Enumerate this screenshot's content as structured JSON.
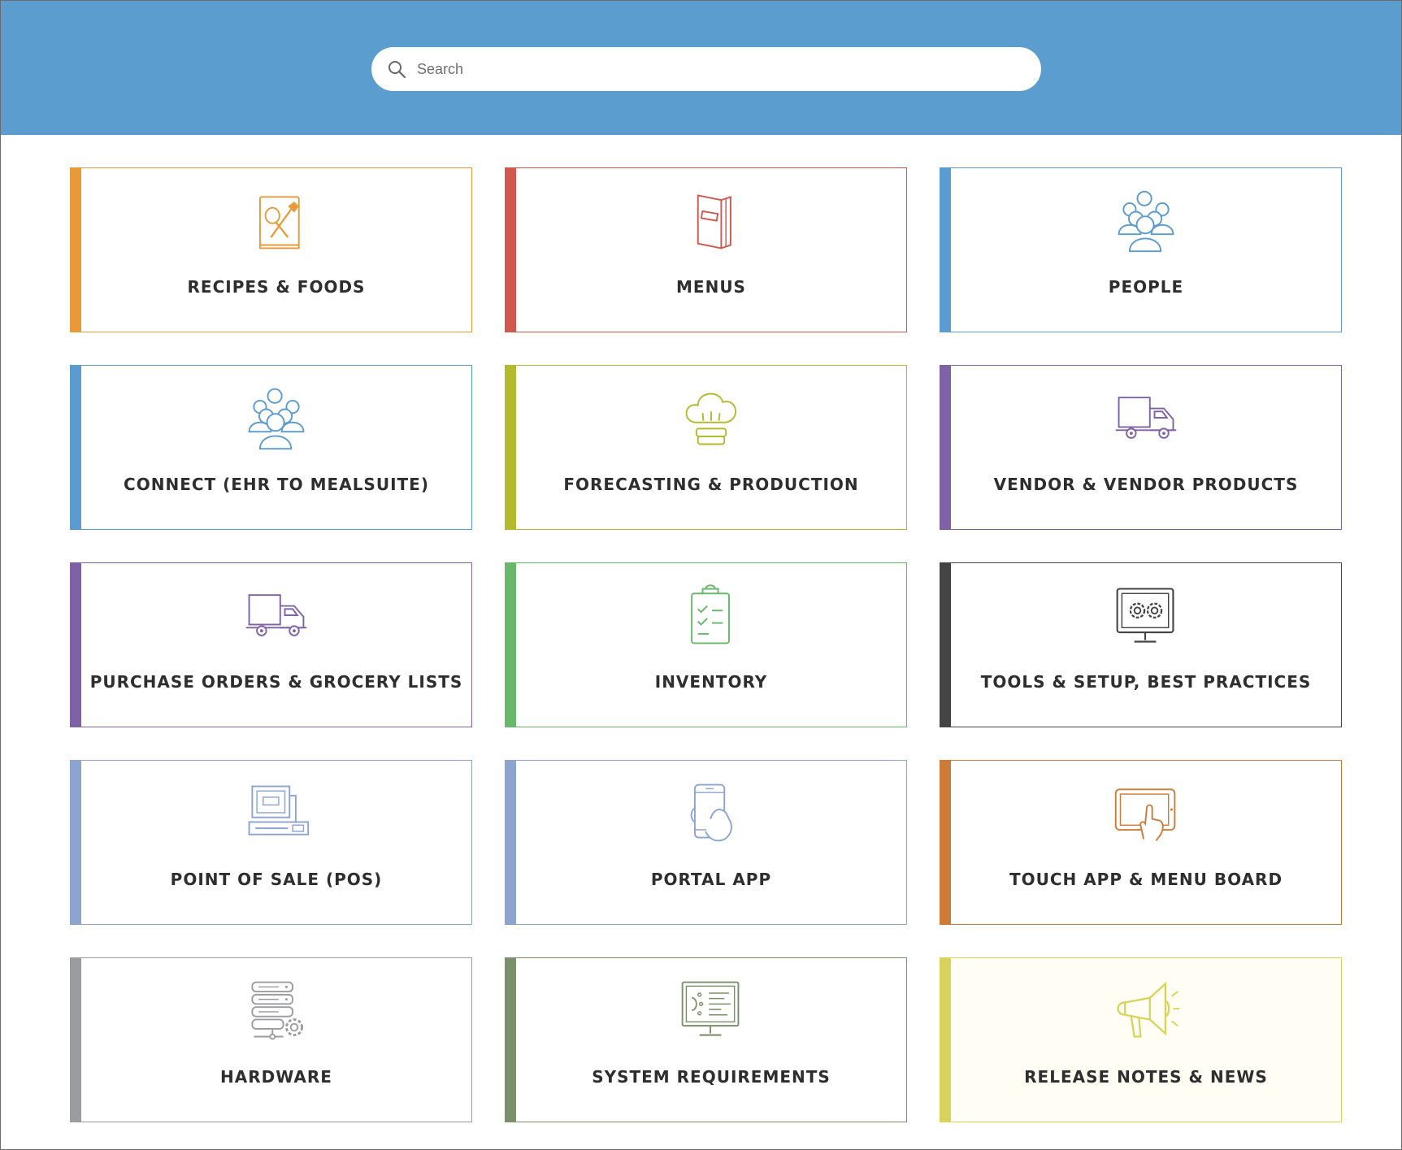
{
  "search": {
    "placeholder": "Search"
  },
  "categories": [
    {
      "label": "RECIPES & FOODS",
      "color": "#e89a38",
      "icon": "recipe-book-icon"
    },
    {
      "label": "MENUS",
      "color": "#d2574f",
      "icon": "menu-book-icon"
    },
    {
      "label": "PEOPLE",
      "color": "#5b9bd0",
      "icon": "people-group-icon"
    },
    {
      "label": "CONNECT (EHR TO MEALSUITE)",
      "color": "#5b9bd0",
      "icon": "people-group-icon"
    },
    {
      "label": "FORECASTING & PRODUCTION",
      "color": "#b3ba2e",
      "icon": "chef-hat-icon"
    },
    {
      "label": "VENDOR & VENDOR PRODUCTS",
      "color": "#7e62a5",
      "icon": "delivery-truck-icon"
    },
    {
      "label": "PURCHASE ORDERS & GROCERY LISTS",
      "color": "#7e62a5",
      "icon": "delivery-truck-icon"
    },
    {
      "label": "INVENTORY",
      "color": "#67b86b",
      "icon": "clipboard-checklist-icon"
    },
    {
      "label": "TOOLS & SETUP, BEST PRACTICES",
      "color": "#444444",
      "icon": "monitor-gears-icon"
    },
    {
      "label": "POINT OF SALE (POS)",
      "color": "#8da4cf",
      "icon": "pos-register-icon"
    },
    {
      "label": "PORTAL APP",
      "color": "#8da4cf",
      "icon": "phone-hand-icon"
    },
    {
      "label": "TOUCH APP & MENU BOARD",
      "color": "#cf7b38",
      "icon": "tablet-touch-icon"
    },
    {
      "label": "HARDWARE",
      "color": "#9a9ca0",
      "icon": "server-gear-icon"
    },
    {
      "label": "SYSTEM REQUIREMENTS",
      "color": "#7a8f6a",
      "icon": "monitor-code-icon"
    },
    {
      "label": "RELEASE NOTES & NEWS",
      "color": "#d8d35a",
      "icon": "megaphone-icon"
    }
  ]
}
